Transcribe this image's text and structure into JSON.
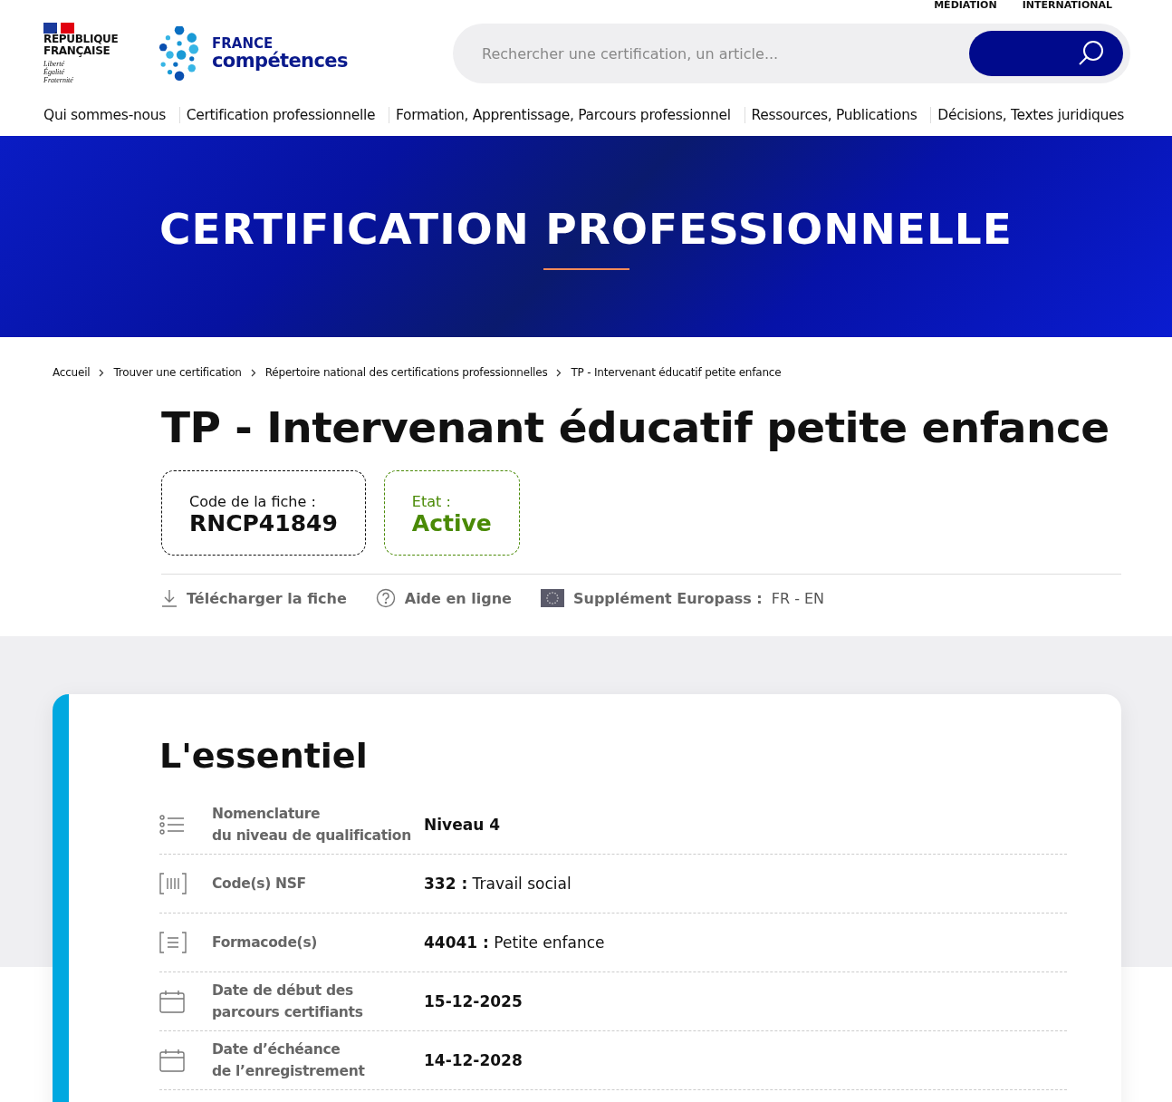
{
  "top_links": [
    "MÉDIATION",
    "INTERNATIONAL"
  ],
  "logo": {
    "republic": "RÉPUBLIQUE\nFRANÇAISE",
    "motto": "Liberté\nÉgalité\nFraternité",
    "brand_top": "FRANCE",
    "brand_bottom": "compétences"
  },
  "search": {
    "placeholder": "Rechercher une certification, un article..."
  },
  "nav": [
    "Qui sommes-nous",
    "Certification professionnelle",
    "Formation, Apprentissage, Parcours professionnel",
    "Ressources, Publications",
    "Décisions, Textes juridiques"
  ],
  "banner": {
    "title": "CERTIFICATION PROFESSIONNELLE"
  },
  "breadcrumb": [
    "Accueil",
    "Trouver une certification",
    "Répertoire national des certifications professionnelles",
    "TP - Intervenant éducatif petite enfance"
  ],
  "title": "TP - Intervenant éducatif petite enfance",
  "code_box": {
    "label": "Code de la fiche :",
    "value": "RNCP41849"
  },
  "status_box": {
    "label": "Etat :",
    "value": "Active",
    "color": "#4a8a06"
  },
  "actions": [
    {
      "kind": "download",
      "label": "Télécharger la fiche"
    },
    {
      "kind": "help",
      "label": "Aide en ligne"
    },
    {
      "kind": "europass",
      "label": "Supplément Europass :",
      "suffix": "FR - EN"
    }
  ],
  "essentiel": {
    "heading": "L'essentiel",
    "rows": [
      {
        "kind": "list",
        "label": "Nomenclature\ndu niveau de qualification",
        "value": "**Niveau 4**"
      },
      {
        "kind": "barcode",
        "label": "Code(s) NSF",
        "value": "**332 :** Travail social"
      },
      {
        "kind": "code",
        "label": "Formacode(s)",
        "value": "**44041 :** Petite enfance"
      },
      {
        "kind": "calendar",
        "label": "Date de début des\nparcours certifiants",
        "value": "**15-12-2025**"
      },
      {
        "kind": "calendar",
        "label": "Date d’échéance\nde l’enregistrement",
        "value": "**14-12-2028**"
      }
    ]
  }
}
